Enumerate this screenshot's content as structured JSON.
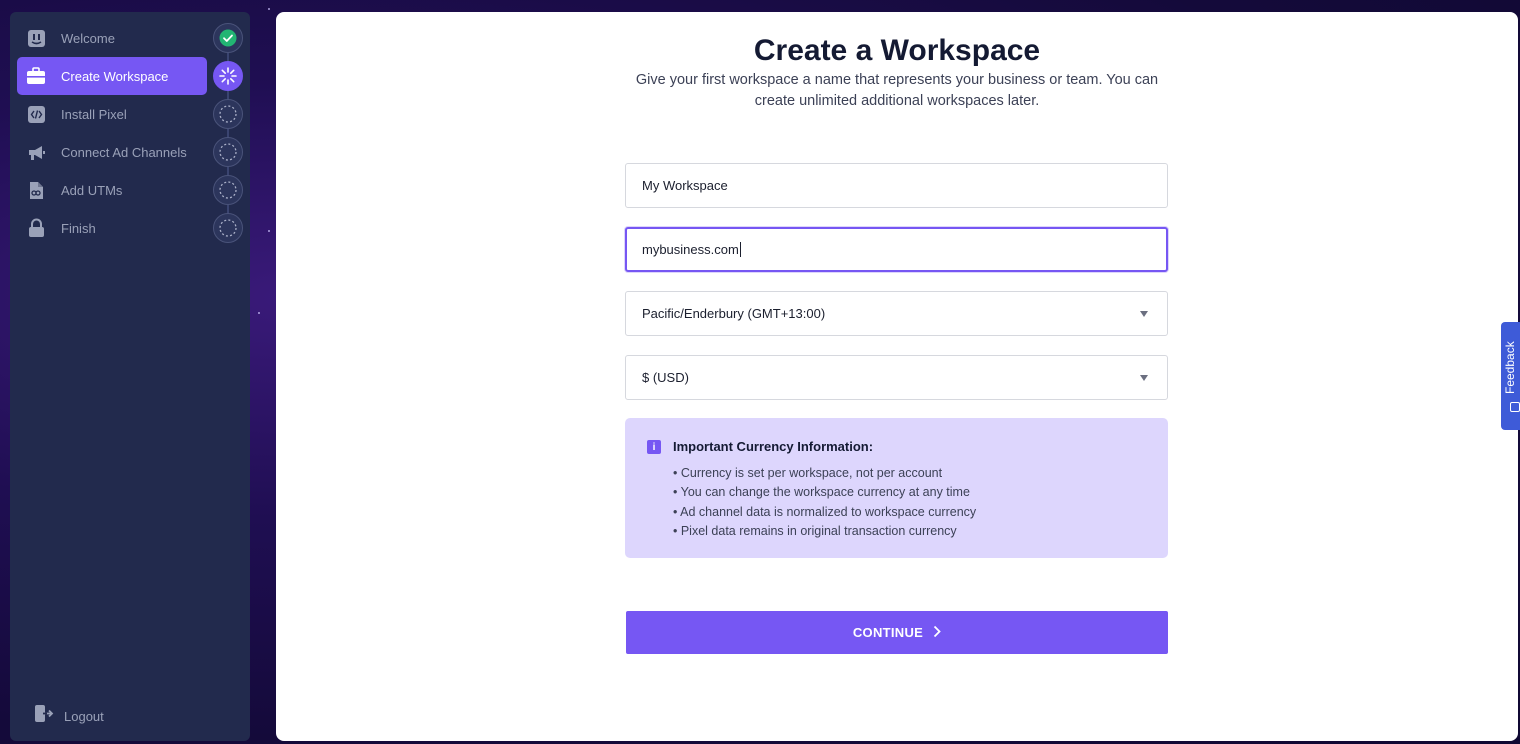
{
  "sidebar": {
    "steps": [
      {
        "label": "Welcome",
        "icon": "waving-face-icon",
        "status": "complete"
      },
      {
        "label": "Create Workspace",
        "icon": "briefcase-icon",
        "status": "in-progress"
      },
      {
        "label": "Install Pixel",
        "icon": "code-icon",
        "status": "pending"
      },
      {
        "label": "Connect Ad Channels",
        "icon": "megaphone-icon",
        "status": "pending"
      },
      {
        "label": "Add UTMs",
        "icon": "document-link-icon",
        "status": "pending"
      },
      {
        "label": "Finish",
        "icon": "lock-icon",
        "status": "pending"
      }
    ],
    "logout_label": "Logout"
  },
  "main": {
    "title": "Create a Workspace",
    "subtitle": "Give your first workspace a name that represents your business or team. You can create unlimited additional workspaces later.",
    "workspace_name": "My Workspace",
    "website": "mybusiness.com",
    "timezone": "Pacific/Enderbury (GMT+13:00)",
    "currency": "$ (USD)",
    "info": {
      "title": "Important Currency Information:",
      "items": [
        "• Currency is set per workspace, not per account",
        "• You can change the workspace currency at any time",
        "• Ad channel data is normalized to workspace currency",
        "• Pixel data remains in original transaction currency"
      ]
    },
    "continue_label": "CONTINUE"
  },
  "feedback_label": "Feedback",
  "colors": {
    "accent": "#7657f3",
    "sidebar_bg": "#222a4d",
    "success": "#22b573",
    "info_bg": "#ddd6fd",
    "feedback_bg": "#3e5bd8"
  }
}
